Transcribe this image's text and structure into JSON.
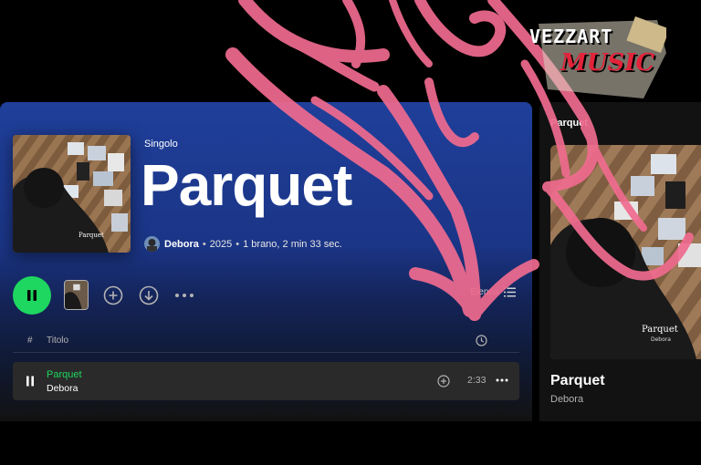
{
  "album": {
    "type_label": "Singolo",
    "title": "Parquet",
    "artist": "Debora",
    "year": "2025",
    "details": "1 brano, 2 min 33 sec.",
    "separator": "•"
  },
  "actions": {
    "list_label": "Elenco"
  },
  "table": {
    "header_index": "#",
    "header_title": "Titolo",
    "rows": [
      {
        "title": "Parquet",
        "artist": "Debora",
        "duration": "2:33"
      }
    ]
  },
  "now_playing": {
    "header": "Parquet",
    "title": "Parquet",
    "artist": "Debora"
  },
  "cover_caption": "Parquet",
  "cover_caption_sub": "Debora",
  "watermark": {
    "line1": "VEZZART",
    "line2": "MUSIC"
  },
  "colors": {
    "accent_green": "#1ed760",
    "header_blue": "#1f3f9a",
    "graffiti_pink": "#f06b8f"
  }
}
